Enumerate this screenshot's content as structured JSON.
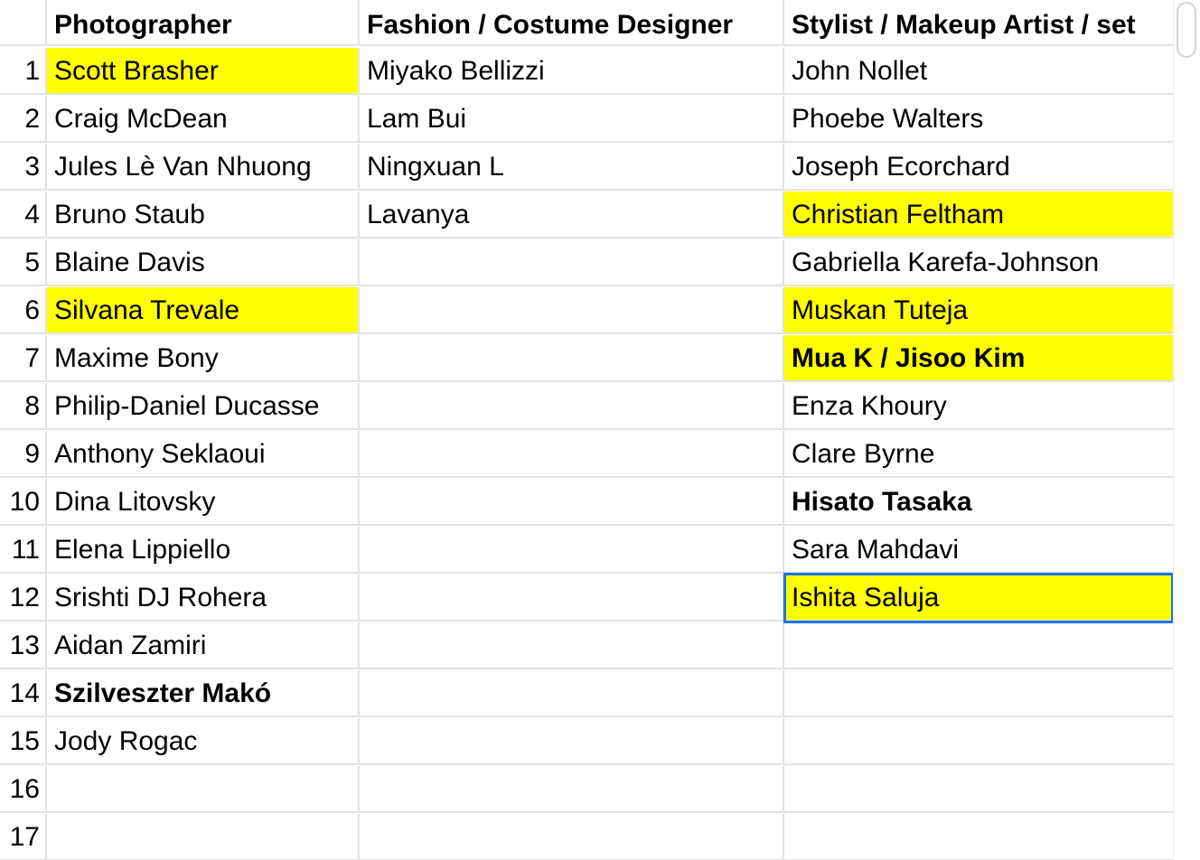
{
  "highlight_color": "#ffff00",
  "selection_color": "#1a73e8",
  "headers": [
    "Photographer",
    "Fashion / Costume Designer",
    "Stylist / Makeup Artist / set"
  ],
  "rows": [
    {
      "num": "1",
      "c1": "Scott Brasher",
      "c2": "Miyako Bellizzi",
      "c3": "John Nollet",
      "hl1": true,
      "hl3": false,
      "b1": false,
      "b3": false
    },
    {
      "num": "2",
      "c1": "Craig McDean",
      "c2": "Lam Bui",
      "c3": "Phoebe Walters",
      "hl1": false,
      "hl3": false,
      "b1": false,
      "b3": false
    },
    {
      "num": "3",
      "c1": "Jules Lè Van Nhuong",
      "c2": "Ningxuan L",
      "c3": "Joseph Ecorchard",
      "hl1": false,
      "hl3": false,
      "b1": false,
      "b3": false
    },
    {
      "num": "4",
      "c1": "Bruno Staub",
      "c2": "Lavanya",
      "c3": "Christian Feltham",
      "hl1": false,
      "hl3": true,
      "b1": false,
      "b3": false
    },
    {
      "num": "5",
      "c1": "Blaine Davis",
      "c2": "",
      "c3": "Gabriella Karefa-Johnson",
      "hl1": false,
      "hl3": false,
      "b1": false,
      "b3": false
    },
    {
      "num": "6",
      "c1": "Silvana Trevale",
      "c2": "",
      "c3": "Muskan Tuteja",
      "hl1": true,
      "hl3": true,
      "b1": false,
      "b3": false
    },
    {
      "num": "7",
      "c1": "Maxime Bony",
      "c2": "",
      "c3": "Mua K / Jisoo Kim",
      "hl1": false,
      "hl3": true,
      "b1": false,
      "b3": true
    },
    {
      "num": "8",
      "c1": "Philip-Daniel Ducasse",
      "c2": "",
      "c3": "Enza Khoury",
      "hl1": false,
      "hl3": false,
      "b1": false,
      "b3": false
    },
    {
      "num": "9",
      "c1": "Anthony Seklaoui",
      "c2": "",
      "c3": "Clare Byrne",
      "hl1": false,
      "hl3": false,
      "b1": false,
      "b3": false
    },
    {
      "num": "10",
      "c1": "Dina Litovsky",
      "c2": "",
      "c3": "Hisato Tasaka",
      "hl1": false,
      "hl3": false,
      "b1": false,
      "b3": true
    },
    {
      "num": "11",
      "c1": "Elena Lippiello",
      "c2": "",
      "c3": "Sara Mahdavi",
      "hl1": false,
      "hl3": false,
      "b1": false,
      "b3": false
    },
    {
      "num": "12",
      "c1": "Srishti DJ Rohera",
      "c2": "",
      "c3": "Ishita Saluja",
      "hl1": false,
      "hl3": true,
      "b1": false,
      "b3": false,
      "sel3": true
    },
    {
      "num": "13",
      "c1": "Aidan Zamiri",
      "c2": "",
      "c3": "",
      "hl1": false,
      "hl3": false,
      "b1": false,
      "b3": false
    },
    {
      "num": "14",
      "c1": "Szilveszter Makó",
      "c2": "",
      "c3": "",
      "hl1": false,
      "hl3": false,
      "b1": true,
      "b3": false
    },
    {
      "num": "15",
      "c1": "Jody Rogac",
      "c2": "",
      "c3": "",
      "hl1": false,
      "hl3": false,
      "b1": false,
      "b3": false
    },
    {
      "num": "16",
      "c1": "",
      "c2": "",
      "c3": "",
      "hl1": false,
      "hl3": false,
      "b1": false,
      "b3": false
    },
    {
      "num": "17",
      "c1": "",
      "c2": "",
      "c3": "",
      "hl1": false,
      "hl3": false,
      "b1": false,
      "b3": false
    }
  ]
}
